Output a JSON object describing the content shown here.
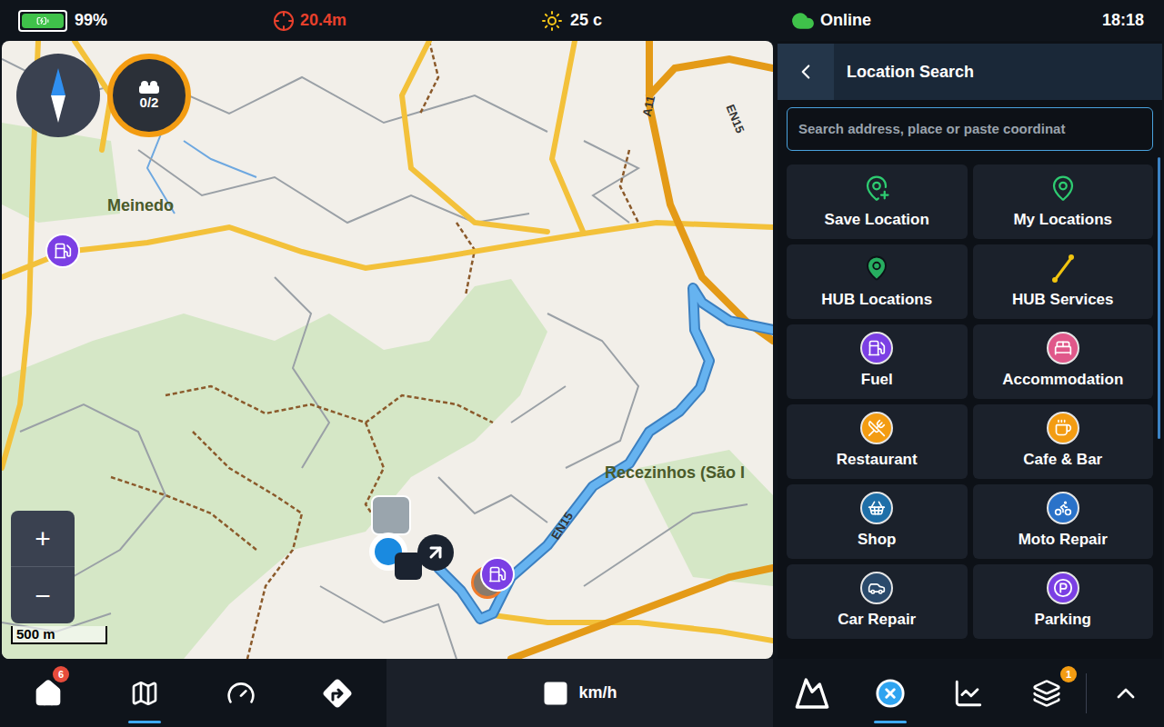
{
  "status_bar": {
    "battery": {
      "text": "99%",
      "level": 0.99
    },
    "gps_accuracy": "20.4m",
    "temperature": "25 c",
    "connection": "Online",
    "time": "18:18"
  },
  "map": {
    "place_labels": [
      "Meinedo",
      "Recezinhos (São I"
    ],
    "road_labels": [
      "A11",
      "EN15",
      "EN15"
    ],
    "waypoint_counter": "0/2",
    "zoom_in": "+",
    "zoom_out": "−",
    "scale": "500 m"
  },
  "panel": {
    "title": "Location Search",
    "search": {
      "placeholder": "Search address, place or paste coordinat"
    },
    "categories": [
      {
        "label": "Save Location",
        "kind": "pin",
        "color": "#2ecc71"
      },
      {
        "label": "My Locations",
        "kind": "pin",
        "color": "#2ecc71"
      },
      {
        "label": "HUB Locations",
        "kind": "pin",
        "color": "#27ae60"
      },
      {
        "label": "HUB Services",
        "kind": "pin",
        "color": "#f1c40f"
      },
      {
        "label": "Fuel",
        "kind": "badge",
        "color": "#7b3fe4"
      },
      {
        "label": "Accommodation",
        "kind": "badge",
        "color": "#e0588a"
      },
      {
        "label": "Restaurant",
        "kind": "badge",
        "color": "#f39c12"
      },
      {
        "label": "Cafe & Bar",
        "kind": "badge",
        "color": "#f39c12"
      },
      {
        "label": "Shop",
        "kind": "badge",
        "color": "#1f6fa8"
      },
      {
        "label": "Moto Repair",
        "kind": "badge",
        "color": "#2a72c9"
      },
      {
        "label": "Car Repair",
        "kind": "badge",
        "color": "#2b4a6b"
      },
      {
        "label": "Parking",
        "kind": "badge",
        "color": "#7b3fe4"
      }
    ]
  },
  "bottom_bar": {
    "left_tabs": [
      {
        "badge": "6",
        "selected": false
      },
      {
        "badge": "",
        "selected": true
      },
      {
        "badge": "",
        "selected": false
      },
      {
        "badge": "",
        "selected": false
      }
    ],
    "speed_unit": "km/h",
    "right_tabs": [
      {
        "badge": "",
        "selected": false
      },
      {
        "badge": "",
        "selected": true
      },
      {
        "badge": "",
        "selected": false
      },
      {
        "badge": "1",
        "selected": false
      }
    ]
  }
}
